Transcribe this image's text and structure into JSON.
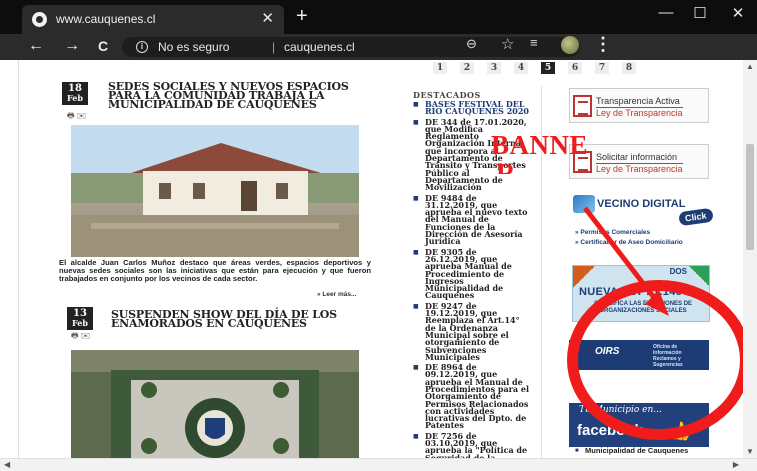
{
  "browser": {
    "tab_title": "www.cauquenes.cl",
    "tab_close": "✕",
    "new_tab": "+",
    "window_minimize": "—",
    "window_maximize": "☐",
    "window_close": "✕",
    "back": "←",
    "forward": "→",
    "reload": "C",
    "info_icon": "i",
    "security_label": "No es seguro",
    "url_separator": "|",
    "url": "cauquenes.cl",
    "zoom_icon": "⊖",
    "star_icon": "☆",
    "extension_icon": "≡",
    "menu_icon": "⋮"
  },
  "pagination": [
    "1",
    "2",
    "3",
    "4",
    "5",
    "6",
    "7",
    "8"
  ],
  "pagination_active": "5",
  "news": [
    {
      "day": "18",
      "month": "Feb",
      "title": "SEDES SOCIALES Y NUEVOS ESPACIOS PARA LA COMUNIDAD TRABAJA LA MUNICIPALIDAD DE CAUQUENES",
      "tools": "🖶  ✉",
      "summary": "El alcalde Juan Carlos Muñoz destaco que áreas verdes, espacios deportivos y nuevas sedes sociales son las iniciativas que están para ejecución y que fueron trabajados en conjunto por los vecinos de cada sector.",
      "read_more": "» Leer más..."
    },
    {
      "day": "13",
      "month": "Feb",
      "title": "SUSPENDEN SHOW DEL DÍA DE LOS ENAMORADOS EN CAUQUENES",
      "tools": "🖶  ✉"
    }
  ],
  "destacados": {
    "heading": "DESTACADOS",
    "items": [
      "BASES FESTIVAL DEL RÍO CAUQUENES 2020",
      "DE 344 de 17.01.2020, que Modifica Reglamento Organización Interna, que incorpora al Departamento de Tránsito y Transportes Público al Departamento de Movilización",
      "DE 9484 de 31.12.2019, que aprueba el nuevo texto del Manual de Funciones de la Dirección de Asesoría Jurídica",
      "DE 9305 de 26.12.2019, que aprueba Manual de Procedimiento de Ingresos Municipalidad de Cauquenes",
      "DE 9247 de 19.12.2019, que Reemplaza el Art.14° de la Ordenanza Municipal sobre el otorgamiento de Subvenciones Municipales",
      "DE 8964 de 09.12.2019, que aprueba el Manual de Procedimientos para el Otorgamiento de Permisos Relacionados con actividades lucrativas del Dpto. de Patentes",
      "DE 7256 de 03.10.2019, que aprueba la \"Política de Seguridad de la"
    ]
  },
  "sidebar": {
    "transparencia_title": "Transparencia Activa",
    "transparencia_sub": "Ley de Transparencia",
    "solicitar_title": "Solicitar información",
    "solicitar_sub": "Ley de Transparencia",
    "vecino_title": "VECINO DIGITAL",
    "vecino_click": "Click",
    "vecino_link1": "» Permisos Comerciales",
    "vecino_link2": "» Certificador de Aseo Domiciliario",
    "ley_corner": "DOS",
    "ley_title": "NUEVA LEY 21.146",
    "ley_sub": "SIMPLIFICA LAS ELECCIONES DE ORGANIZACIONES SOCIALES",
    "oirs_title": "OIRS",
    "oirs_sub": "Oficina de Información Reclamos y Sugerencias",
    "fb_heading": "Tu Municipio en...",
    "fb_logo": "facebook.",
    "fb_link": "Municipalidad de Cauquenes"
  },
  "annotation": {
    "label_line1": "BANNE",
    "label_line2": "R",
    "color": "#f01c1c"
  }
}
